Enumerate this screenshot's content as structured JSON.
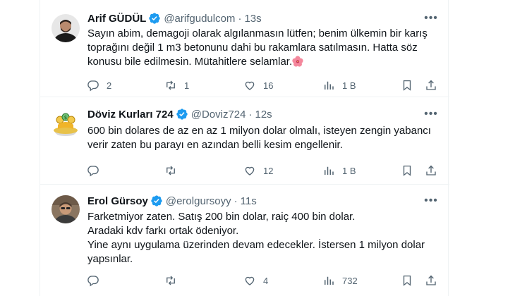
{
  "tweets": [
    {
      "name": "Arif GÜDÜL",
      "handle": "@arifgudulcom",
      "time": "13s",
      "lines": [
        "Sayın abim, demagoji olarak algılanmasın lütfen; benim ülkemin bir karış",
        "toprağını değil 1 m3 betonunu dahi bu rakamlara satılmasın. Hatta söz",
        "konusu bile edilmesin. Mütahitlere selamlar."
      ],
      "replies": "2",
      "retweets": "1",
      "likes": "16",
      "views": "1 B"
    },
    {
      "name": "Döviz Kurları 724",
      "handle": "@Doviz724",
      "time": "12s",
      "lines": [
        "600 bin dolares de az en az 1 milyon dolar olmalı, isteyen zengin yabancı",
        "verir zaten bu parayı en azından belli kesim engellenir."
      ],
      "replies": "",
      "retweets": "",
      "likes": "12",
      "views": "1 B"
    },
    {
      "name": "Erol Gürsoy",
      "handle": "@erolgursoyy",
      "time": "11s",
      "lines": [
        "Farketmiyor zaten. Satış 200 bin dolar, raiç 400 bin dolar.",
        "Aradaki kdv farkı ortak ödeniyor.",
        "Yine aynı uygulama üzerinden devam edecekler. İstersen  1 milyon dolar",
        "yapsınlar."
      ],
      "replies": "",
      "retweets": "",
      "likes": "4",
      "views": "732"
    }
  ],
  "colors": {
    "verified": "#1d9bf0",
    "muted": "#536471",
    "text": "#0f1419",
    "divider": "#eff3f4"
  },
  "icons": {
    "reply": "reply-icon",
    "retweet": "retweet-icon",
    "like": "heart-icon",
    "views": "views-icon",
    "bookmark": "bookmark-icon",
    "share": "share-icon",
    "more": "more-icon",
    "verified": "verified-badge-icon"
  }
}
